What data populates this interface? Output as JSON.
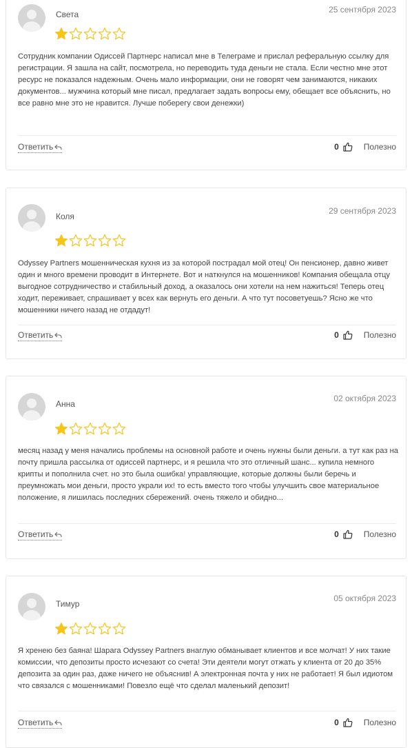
{
  "colors": {
    "star_filled": "#f5c518",
    "star_empty": "#f5c518",
    "border": "#e6e6e6"
  },
  "reviews": [
    {
      "author": "Света",
      "date": "25 сентября 2023",
      "rating": 1,
      "rating_max": 5,
      "text": "Сотрудник компании Одиссей Партнерс написал мне в Телеграме и прислал реферальную ссылку для регистрации. Я зашла на сайт, посмотрела, но переводить туда деньги не стала. Если честно мне этот ресурс не показался надежным. Очень мало информации, они не говорят чем занимаются, никаких документов... мужчина который мне писал, предлагает задать вопросы ему, обещает все объяснить, но все равно мне это не нравится. Лучше поберегу свои денежки)",
      "reply_label": "Ответить",
      "likes": "0",
      "helpful_label": "Полезно"
    },
    {
      "author": "Коля",
      "date": "29 сентября 2023",
      "rating": 1,
      "rating_max": 5,
      "text": "Odyssey Partners мошенническая кухня из за которой пострадал мой отец! Он пенсионер, давно живет один и много времени проводит в Интернете. Вот и наткнулся на мошенников! Компания обещала отцу выгодное сотрудничество и стабильный доход, а оказалось они хотели на нем нажиться! Теперь отец ходит, переживает, спрашивает у всех как вернуть его деньги. А что тут посоветуешь? Ясно же что мошенники ничего назад не отдадут!",
      "reply_label": "Ответить",
      "likes": "0",
      "helpful_label": "Полезно"
    },
    {
      "author": "Анна",
      "date": "02 октября 2023",
      "rating": 1,
      "rating_max": 5,
      "text": "месяц назад у меня начались проблемы на основной работе и очень нужны были деньги. а тут как раз на почту пришла рассылка от одиссей партнерс, и я решила что это отличный шанс... купила немного крипты и пополнила счет. но это была ошибка! управляющие, которые должны были беречь и преумножать мои деньги, просто украли их! то есть вместо того чтобы улучшить свое материальное положение, я лишилась последних сбережений. очень тяжело и обидно...",
      "reply_label": "Ответить",
      "likes": "0",
      "helpful_label": "Полезно"
    },
    {
      "author": "Тимур",
      "date": "05 октября 2023",
      "rating": 1,
      "rating_max": 5,
      "text": "Я хренею без баяна! Шарага Odyssey Partners внаглую обманывает клиентов и все молчат! У них такие комиссии, что депозиты просто исчезают со счета! Эти деятели могут отжать у клиента от 20 до 35% депозита за один раз, даже ничего не объяснив! А электронная почта у них не работает! Я был идиотом что связался с мошенниками! Повезло ещё что сделал маленький депозит!",
      "reply_label": "Ответить",
      "likes": "0",
      "helpful_label": "Полезно"
    }
  ]
}
